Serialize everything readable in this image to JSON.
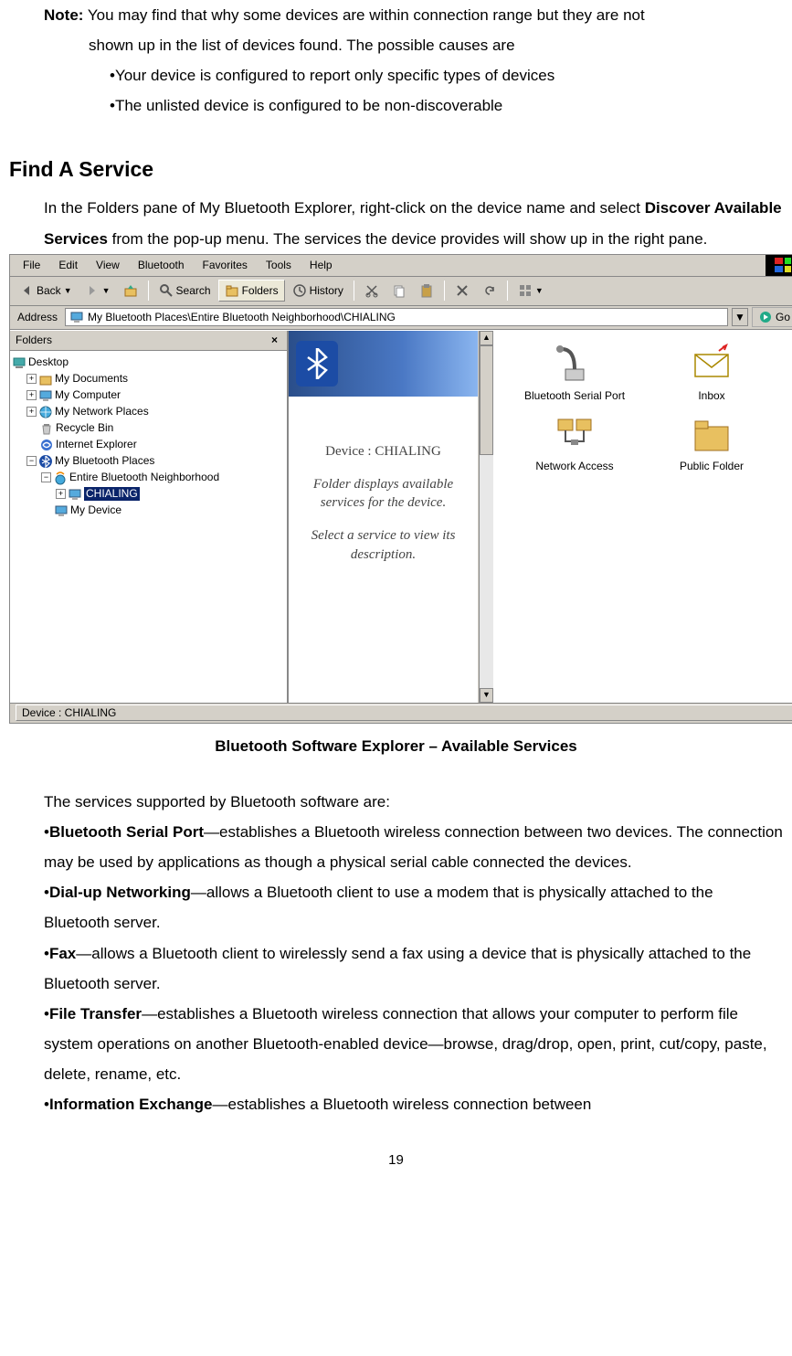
{
  "note": {
    "label": "Note:",
    "text1": " You may find that why some devices are within connection range but they are not",
    "text2": "shown up in the list of devices found. The possible causes are",
    "bullet1": "•Your device is configured to report only specific types of devices",
    "bullet2": "•The unlisted device is configured to be non-discoverable"
  },
  "heading": "Find A Service",
  "intro": {
    "line1": "In the Folders pane of My Bluetooth Explorer, right-click on the device name and select ",
    "strong": "Discover Available Services",
    "line2": " from the pop-up menu. The services the device provides will show up in the right pane."
  },
  "screenshot": {
    "menus": [
      "File",
      "Edit",
      "View",
      "Bluetooth",
      "Favorites",
      "Tools",
      "Help"
    ],
    "toolbar": {
      "back": "Back",
      "search": "Search",
      "folders": "Folders",
      "history": "History"
    },
    "address": {
      "label": "Address",
      "path": "My Bluetooth Places\\Entire Bluetooth Neighborhood\\CHIALING",
      "go": "Go"
    },
    "folders_title": "Folders",
    "tree": {
      "desktop": "Desktop",
      "mydocs": "My Documents",
      "mycomp": "My Computer",
      "mynet": "My Network Places",
      "recycle": "Recycle Bin",
      "ie": "Internet Explorer",
      "mybt": "My Bluetooth Places",
      "entire": "Entire Bluetooth Neighborhood",
      "chialing": "CHIALING",
      "mydevice": "My Device"
    },
    "info": {
      "device": "Device : CHIALING",
      "line1": "Folder displays available services for the device.",
      "line2": "Select a service to view its description."
    },
    "services": {
      "serial": "Bluetooth Serial Port",
      "inbox": "Inbox",
      "network": "Network Access",
      "public": "Public Folder"
    },
    "status": "Device : CHIALING"
  },
  "caption": "Bluetooth Software Explorer – Available Services",
  "services_intro": "The services supported by Bluetooth software are:",
  "services": {
    "serial": {
      "name": "Bluetooth Serial Port",
      "desc": "—establishes a Bluetooth wireless connection between two devices. The connection may be used by applications as though a physical serial cable connected the devices."
    },
    "dialup": {
      "name": "Dial-up Networking",
      "desc": "—allows a Bluetooth client to use a modem that is physically attached to the Bluetooth server."
    },
    "fax": {
      "name": "Fax",
      "desc": "—allows a Bluetooth client to wirelessly send a fax using a device that is physically attached to the Bluetooth server."
    },
    "filetransfer": {
      "name": "File Transfer",
      "desc": "—establishes a Bluetooth wireless connection that allows your computer to perform file system operations on another Bluetooth-enabled device—browse, drag/drop, open, print, cut/copy, paste, delete, rename, etc."
    },
    "infoex": {
      "name": "Information Exchange",
      "desc": "—establishes a Bluetooth wireless connection between"
    }
  },
  "page_number": "19"
}
